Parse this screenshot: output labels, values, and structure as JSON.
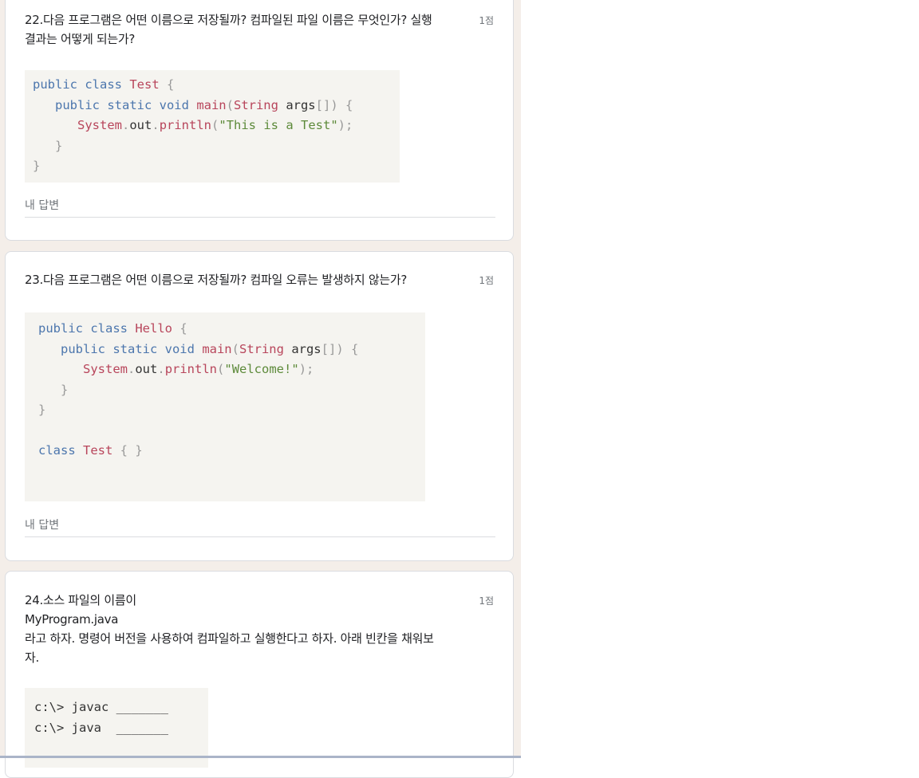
{
  "q22": {
    "text": "22.다음 프로그램은 어떤 이름으로 저장될까? 컴파일된 파일 이름은 무엇인가? 실행\n결과는 어떻게 되는가?",
    "points": "1점",
    "code": {
      "l1_kw": "public class ",
      "l1_cls": "Test",
      "l1_p": " {",
      "l2_kw": "public static void ",
      "l2_fn": "main",
      "l2_p1": "(",
      "l2_ty": "String",
      "l2_arg": " args",
      "l2_p2": "[]) {",
      "l3_obj": "System",
      "l3_p1": ".",
      "l3_out": "out",
      "l3_p2": ".",
      "l3_fn": "println",
      "l3_p3": "(",
      "l3_str": "\"This is a Test\"",
      "l3_p4": ");",
      "l4": "}",
      "l5": "}"
    },
    "answer_label": "내 답변"
  },
  "q23": {
    "text": "23.다음 프로그램은 어떤 이름으로 저장될까? 컴파일 오류는 발생하지 않는가?",
    "points": "1점",
    "code": {
      "l1_kw": "public class ",
      "l1_cls": "Hello",
      "l1_p": " {",
      "l2_kw": "public static void ",
      "l2_fn": "main",
      "l2_p1": "(",
      "l2_ty": "String",
      "l2_arg": " args",
      "l2_p2": "[]) {",
      "l3_obj": "System",
      "l3_p1": ".",
      "l3_out": "out",
      "l3_p2": ".",
      "l3_fn": "println",
      "l3_p3": "(",
      "l3_str": "\"Welcome!\"",
      "l3_p4": ");",
      "l4": "}",
      "l5": "}",
      "l7_kw": "class ",
      "l7_cls": "Test",
      "l7_p": " { }"
    },
    "answer_label": "내 답변"
  },
  "q24": {
    "text": "24.소스 파일의 이름이\nMyProgram.java\n라고 하자. 명령어 버전을 사용하여 컴파일하고 실행한다고 하자. 아래 빈칸을 채워보\n자.",
    "points": "1점",
    "code": {
      "l1": "c:\\> javac _______",
      "l2": "c:\\> java  _______"
    }
  }
}
